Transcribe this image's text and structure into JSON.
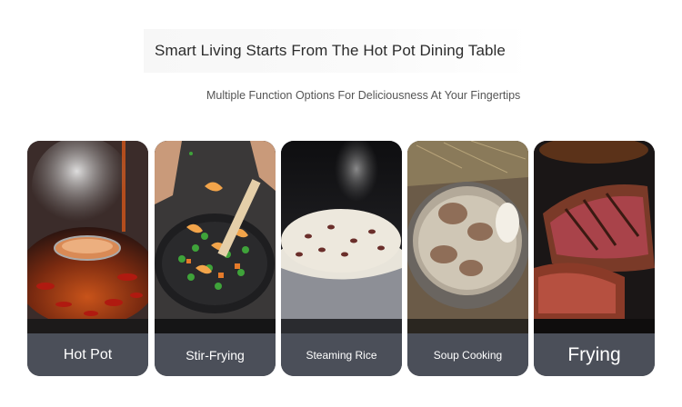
{
  "header": {
    "title": "Smart Living Starts From The Hot Pot Dining Table",
    "subtitle": "Multiple Function Options For Deliciousness At Your Fingertips"
  },
  "cards": [
    {
      "label": "Hot Pot",
      "image": "hot-pot-photo"
    },
    {
      "label": "Stir-Frying",
      "image": "stir-frying-photo"
    },
    {
      "label": "Steaming Rice",
      "image": "steaming-rice-photo"
    },
    {
      "label": "Soup Cooking",
      "image": "soup-cooking-photo"
    },
    {
      "label": "Frying",
      "image": "frying-steak-photo"
    }
  ],
  "colors": {
    "label_bar": "#4b4f59",
    "label_text": "#ffffff",
    "title_text": "#2c2c2c",
    "subtitle_text": "#555555"
  }
}
